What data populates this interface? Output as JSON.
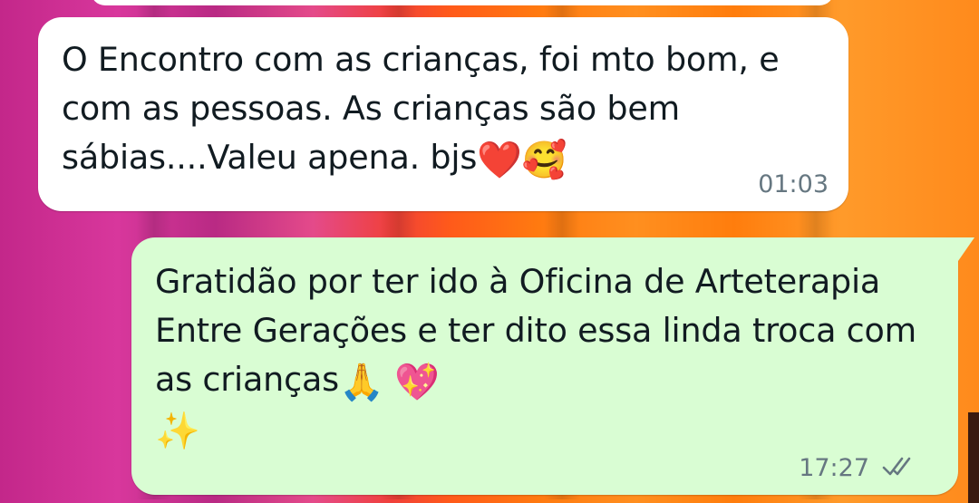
{
  "chat": {
    "messages": [
      {
        "direction": "incoming",
        "text": "O Encontro com as crianças, foi mto bom, e com as pessoas. As crianças são bem sábias....Valeu apena. bjs",
        "emojis": [
          "❤️",
          "🥰"
        ],
        "time": "01:03"
      },
      {
        "direction": "outgoing",
        "text": "Gratidão por ter ido à Oficina de Arteterapia Entre Gerações e ter dito essa linda troca com as crianças",
        "emojis": [
          "🙏",
          "💖",
          "✨"
        ],
        "time": "17:27",
        "status_icon": "double-check-icon"
      }
    ]
  },
  "colors": {
    "incoming_bubble": "#ffffff",
    "outgoing_bubble": "#d9fdd3",
    "timestamp": "#667781",
    "text": "#111b21"
  }
}
